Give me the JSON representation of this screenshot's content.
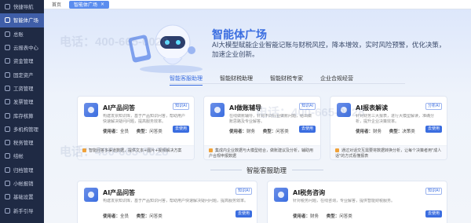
{
  "sidebar": {
    "items": [
      {
        "label": "快捷导航"
      },
      {
        "label": "智能体广场",
        "active": true
      },
      {
        "label": "总账"
      },
      {
        "label": "云报表中心"
      },
      {
        "label": "资金管理"
      },
      {
        "label": "固定资产"
      },
      {
        "label": "工资管理"
      },
      {
        "label": "发票管理"
      },
      {
        "label": "库存核算"
      },
      {
        "label": "多机构管理"
      },
      {
        "label": "税务管理"
      },
      {
        "label": "结帐"
      },
      {
        "label": "归档管理"
      },
      {
        "label": "小帐报销"
      },
      {
        "label": "基础设置"
      },
      {
        "label": "新手引导"
      }
    ]
  },
  "tabbar": {
    "home": "首页",
    "active_tab": "智能体广场",
    "close": "×"
  },
  "hero": {
    "title": "智能体广场",
    "description": "AI大模型赋能企业智能记账与财税风控，降本增效，实时风险预警，优化决策，加速企业创新。"
  },
  "category_tabs": [
    "智能客服助理",
    "智能财税助理",
    "智能财税专家",
    "企业合规经营"
  ],
  "cards_top": [
    {
      "title": "AI产品问答",
      "tag": "知识AI",
      "desc": "构建发票知识库，基于产品知识问答，帮助用户快速解决疑问问题，提高服务效率。",
      "meta_user_label": "使用者：",
      "meta_user": "全员",
      "meta_type_label": "类型：",
      "meta_type": "问答类",
      "button": "去使用",
      "footer": "智能回答多渠道数据，提供文本+图片+视频解决方案"
    },
    {
      "title": "AI做账辅导",
      "tag": "知识AI",
      "desc": "在线做账辅导，针对不同行业做账问题，给出做账思路及专业解答。",
      "meta_user_label": "使用者：",
      "meta_user": "财务",
      "meta_type_label": "类型：",
      "meta_type": "问答类",
      "button": "去使用",
      "footer": "集成内企业数据与大模型结合，做账建议及分析，辅助用户合规申报数据"
    },
    {
      "title": "AI报表解读",
      "tag": "分析AI",
      "desc": "针对财务三大报表，进行大模型解读，准确分析，提升企业决策效率。",
      "meta_user_label": "使用者：",
      "meta_user": "财务",
      "meta_type_label": "类型：",
      "meta_type": "决策类",
      "button": "去使用",
      "footer": "通过对话交互需要将数据转换分析，让每个决策者用\"成人话\"的方式看懂报表"
    }
  ],
  "section_title": "智能客服助理",
  "cards_bottom": [
    {
      "title": "AI产品问答",
      "tag": "知识AI",
      "desc": "构建发票知识库，基于产品知识问答，帮助用户快速解决疑问问题，提高服务效率。",
      "meta_user_label": "使用者：",
      "meta_user": "全员",
      "meta_type_label": "类型：",
      "meta_type": "问答类",
      "button": "去使用"
    },
    {
      "title": "AI税务咨询",
      "tag": "知识AI",
      "desc": "针对税务问题，在线咨询，专业解答，提供智能财税服务。",
      "meta_user_label": "使用者：",
      "meta_user": "财务",
      "meta_type_label": "类型：",
      "meta_type": "问答类",
      "button": "去使用"
    }
  ],
  "watermark": "电话：400-665-0028",
  "colors": {
    "accent": "#3a6de0",
    "sidebar": "#1f2a44"
  }
}
